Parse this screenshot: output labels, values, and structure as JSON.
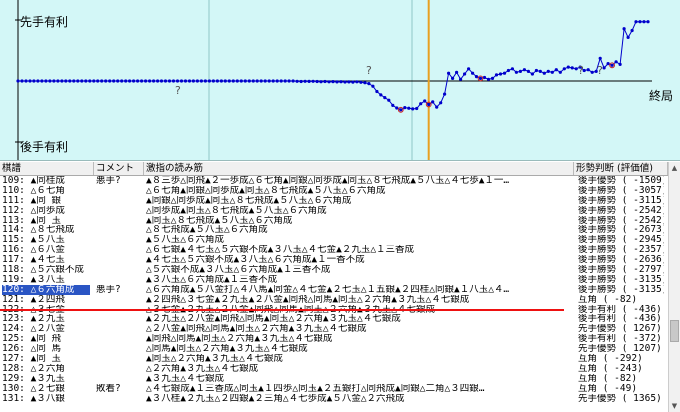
{
  "graph": {
    "top_label": "先手有利",
    "bottom_label": "後手有利",
    "end_label": "終局",
    "marker_symbol": "?",
    "colors": {
      "background": "#d3f7f7",
      "line": "#0000cc",
      "axis": "#000000",
      "cursor": "#e8a020",
      "marker": "#cc2222"
    }
  },
  "chart_data": {
    "type": "line",
    "xlabel": "",
    "ylabel": "",
    "series": [
      {
        "values": [
          0,
          0,
          0,
          0,
          0,
          0,
          0,
          0,
          0,
          0,
          0,
          0,
          0,
          0,
          0,
          0,
          0,
          0,
          0,
          0,
          0,
          0,
          0,
          0,
          0,
          0,
          0,
          0,
          0,
          0,
          0,
          0,
          0,
          0,
          0,
          0,
          0,
          0,
          0,
          0,
          0,
          0,
          0,
          0,
          0,
          0,
          0,
          0,
          0,
          0,
          0,
          0,
          0,
          0,
          0,
          0,
          0,
          0,
          0,
          0,
          0,
          0,
          0,
          0,
          0,
          0,
          0,
          0,
          0,
          0,
          -30,
          -60,
          -40,
          -50,
          -40,
          -60,
          -80,
          -60,
          -90,
          -70,
          -100,
          -80,
          -120,
          -100,
          -130,
          -90,
          -150,
          -200,
          -300,
          -600,
          -1200,
          -1600,
          -1900,
          -2200,
          -2800,
          -3100,
          -3300,
          -3050,
          -3120,
          -3200,
          -3150,
          -2600,
          -2300,
          -2700,
          -2400,
          -3000,
          -2500,
          -1500,
          900,
          300,
          1000,
          200,
          800,
          1400,
          900,
          500,
          300,
          400,
          200,
          300,
          700,
          800,
          900,
          1200,
          1400,
          1000,
          1100,
          1300,
          1100,
          800,
          1200,
          1100,
          900,
          1100,
          1000,
          1300,
          1000,
          1400,
          1600,
          1500,
          1400,
          1600,
          1200,
          1300,
          1000,
          1100,
          2600,
          1500,
          2000,
          1800,
          2200,
          1900,
          6000,
          5000,
          5800,
          6800,
          6800,
          6800,
          6800
        ]
      }
    ]
  },
  "table": {
    "headers": [
      "棋譜",
      "コメント",
      "激指の読み筋",
      "形勢判断 (評価値)"
    ],
    "rows": [
      {
        "move": "109: ▲同桂成",
        "comment": "悪手?",
        "pv": "▲８三歩△同飛▲２一歩成△６七角▲同銀△同歩成▲同玉△８七飛成▲５八玉△４七歩▲１一…",
        "judge": "後手優勢 ( -1509)"
      },
      {
        "move": "110: △６七角",
        "comment": "",
        "pv": "△６七角▲同銀△同歩成▲同玉△８七飛成▲５八玉△６六角成",
        "judge": "後手勝勢 ( -3057)"
      },
      {
        "move": "111: ▲同 銀",
        "comment": "",
        "pv": "▲同銀△同歩成▲同玉△８七飛成▲５八玉△６六角成",
        "judge": "後手勝勢 ( -3115)"
      },
      {
        "move": "112: △同歩成",
        "comment": "",
        "pv": "△同歩成▲同玉△８七飛成▲５八玉△６六角成",
        "judge": "後手勝勢 ( -2542)"
      },
      {
        "move": "113: ▲同 玉",
        "comment": "",
        "pv": "▲同玉△８七飛成▲５八玉△６六角成",
        "judge": "後手勝勢 ( -2542)"
      },
      {
        "move": "114: △８七飛成",
        "comment": "",
        "pv": "△８七飛成▲５八玉△６六角成",
        "judge": "後手勝勢 ( -2673)"
      },
      {
        "move": "115: ▲５八玉",
        "comment": "",
        "pv": "▲５八玉△６六角成",
        "judge": "後手勝勢 ( -2945)"
      },
      {
        "move": "116: △６八金",
        "comment": "",
        "pv": "△６七銀▲４七玉△５六銀不成▲３八玉△４七金▲２九玉△１三香成",
        "judge": "後手勝勢 ( -2357)"
      },
      {
        "move": "117: ▲４七玉",
        "comment": "",
        "pv": "▲４七玉△５六銀不成▲３八玉△６六角成▲１一香不成",
        "judge": "後手勝勢 ( -2636)"
      },
      {
        "move": "118: △５六銀不成",
        "comment": "",
        "pv": "△５六銀不成▲３八玉△６六角成▲１三香不成",
        "judge": "後手勝勢 ( -2797)"
      },
      {
        "move": "119: ▲３八玉",
        "comment": "",
        "pv": "▲３八玉△６六角成▲１三香不成",
        "judge": "後手勝勢 ( -3135)"
      },
      {
        "move": "120: △６六角成",
        "comment": "悪手?",
        "pv": "△６六角成▲５八金打△４八馬▲同金△４七金▲２七玉△１五銀▲２四桂△同銀▲１八玉△４…",
        "judge": "後手勝勢 ( -3135)"
      },
      {
        "move": "121: ▲２四飛",
        "comment": "",
        "pv": "▲２四飛△３七金▲２九玉▲２八金▲同飛△同馬▲同玉△２六角▲３九玉△４七銀成",
        "judge": "互角 ( -82)"
      },
      {
        "move": "122: △３七金",
        "comment": "",
        "pv": "△３七金▲２九玉△２八金▲同飛△同馬▲同玉△２六角▲３九玉△４七銀成",
        "judge": "後手有利 ( -436)"
      },
      {
        "move": "123: ▲２九玉",
        "comment": "",
        "pv": "▲２九玉△２八金▲同飛△同馬▲同玉△２六角▲３九玉△４七銀成",
        "judge": "後手有利 ( -436)"
      },
      {
        "move": "124: △２八金",
        "comment": "",
        "pv": "△２八金▲同飛△同馬▲同玉△２六角▲３九玉△４七銀成",
        "judge": "先手優勢 ( 1267)"
      },
      {
        "move": "125: ▲同 飛",
        "comment": "",
        "pv": "▲同飛△同馬▲同玉△２六角▲３九玉△４七銀成",
        "judge": "後手有利 ( -372)"
      },
      {
        "move": "126: △同 馬",
        "comment": "",
        "pv": "△同馬▲同玉△２六角▲３九玉△４七銀成",
        "judge": "先手優勢 ( 1207)"
      },
      {
        "move": "127: ▲同 玉",
        "comment": "",
        "pv": "▲同玉△２六角▲３九玉△４七銀成",
        "judge": "互角 ( -292)"
      },
      {
        "move": "128: △２六角",
        "comment": "",
        "pv": "△２六角▲３九玉△４七銀成",
        "judge": "互角 ( -243)"
      },
      {
        "move": "129: ▲３九玉",
        "comment": "",
        "pv": "▲３九玉△４七銀成",
        "judge": "互角 ( -82)"
      },
      {
        "move": "130: △２七銀",
        "comment": "敗着?",
        "pv": "△４七銀成▲１三香成△同玉▲１四歩△同玉▲２五銀打△同飛成▲同銀△二角△３四銀…",
        "judge": "互角 ( -49)"
      },
      {
        "move": "131: ▲３八銀",
        "comment": "",
        "pv": "▲３八桂▲２九玉△２四銀▲２三角△４七歩成▲５八金△２六飛成",
        "judge": "先手優勢 ( 1365)"
      }
    ]
  }
}
